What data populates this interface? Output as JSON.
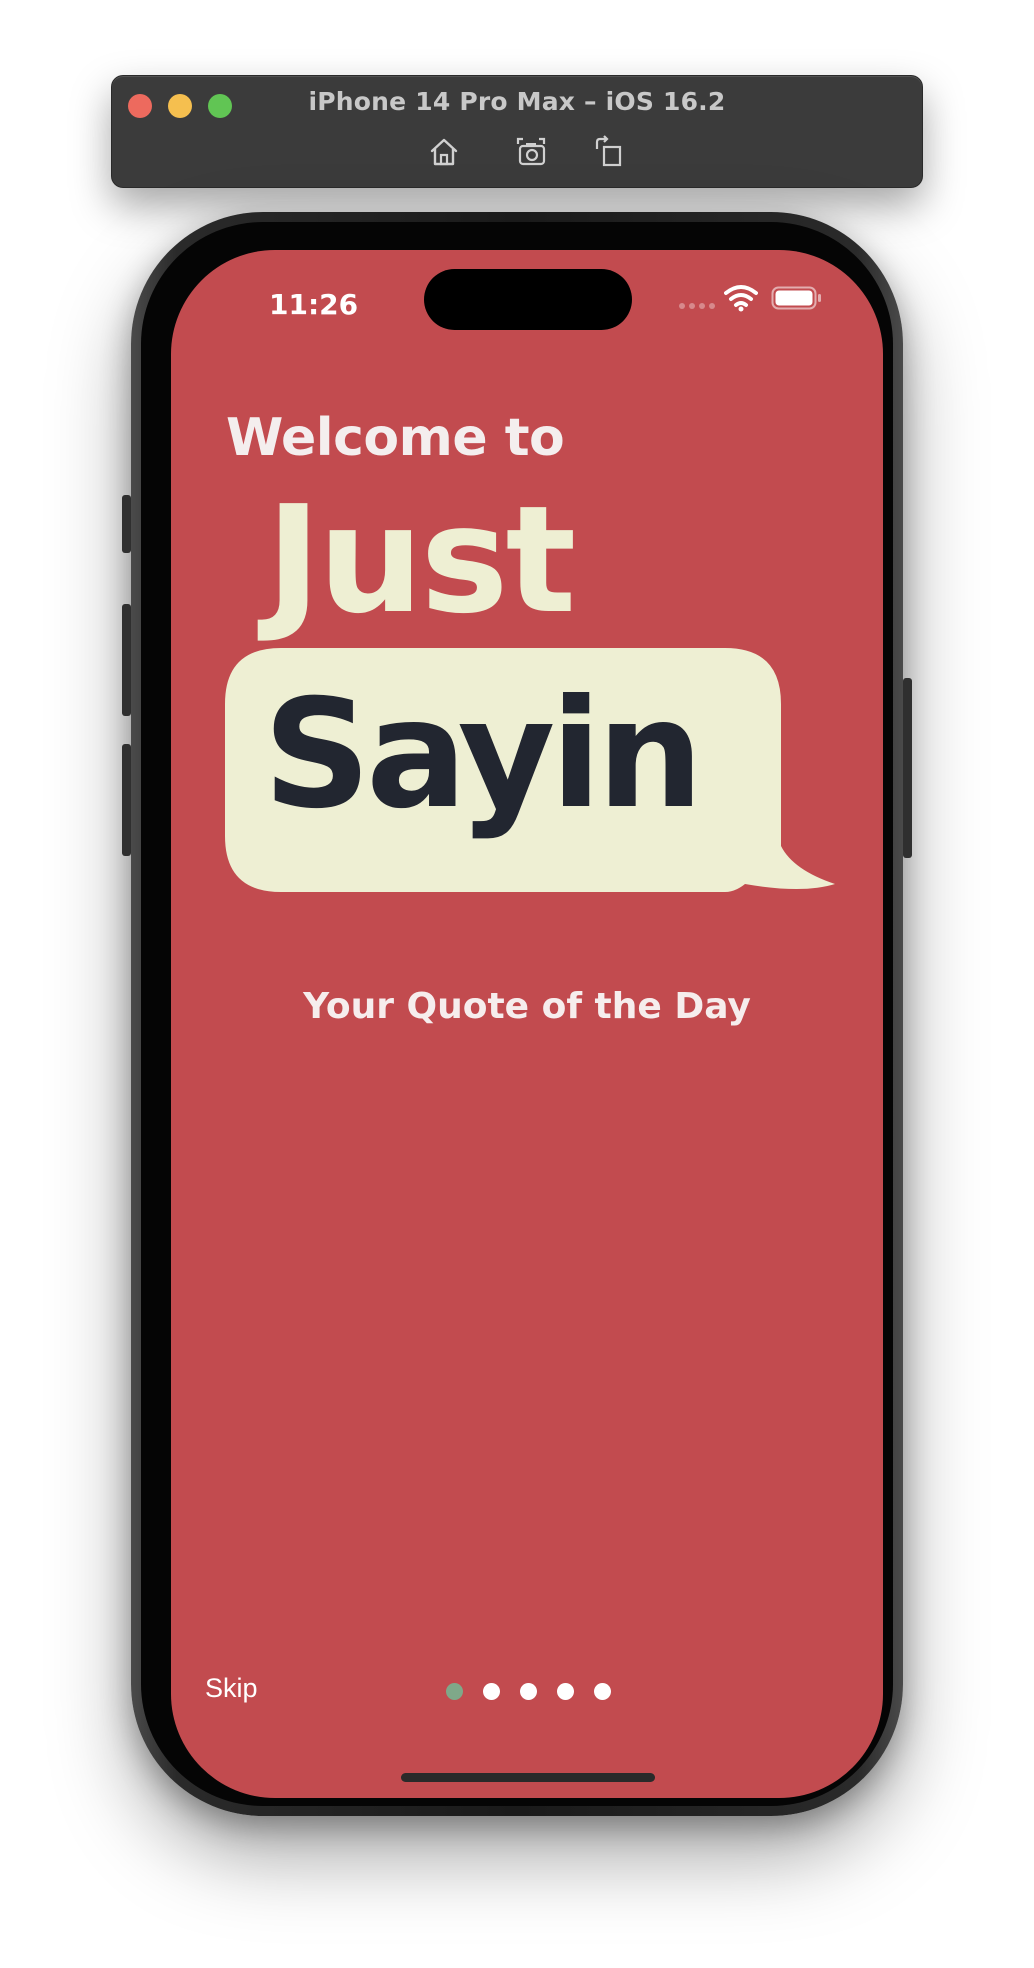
{
  "simulator": {
    "title": "iPhone 14 Pro Max – iOS 16.2",
    "toolbar": [
      "home-icon",
      "screenshot-icon",
      "rotate-icon"
    ]
  },
  "status_bar": {
    "time": "11:26",
    "icons": [
      "cellular-signal-icon",
      "wifi-icon",
      "battery-icon"
    ]
  },
  "onboarding": {
    "welcome": "Welcome to",
    "logo_line1": "Just",
    "logo_line2": "Sayin",
    "tagline": "Your Quote of the Day",
    "skip_label": "Skip",
    "pages_total": 5,
    "current_page": 1
  },
  "colors": {
    "background": "#c24b4f",
    "logo_cream": "#eeefd3",
    "logo_dark": "#222630",
    "active_dot": "#7fa889",
    "inactive_dot": "#ffffff"
  }
}
